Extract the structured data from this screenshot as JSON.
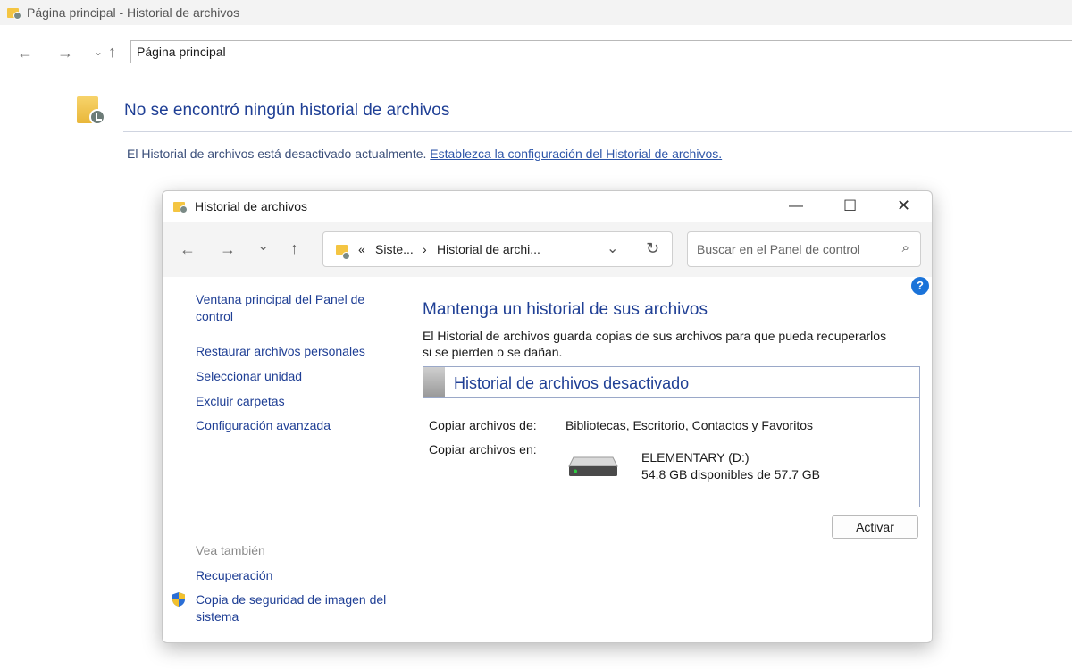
{
  "background_window": {
    "title": "Página principal - Historial de archivos",
    "address": "Página principal",
    "heading": "No se encontró ningún historial de archivos",
    "info_text": "El Historial de archivos está desactivado actualmente.",
    "info_link": "Establezca la configuración del Historial de archivos."
  },
  "dialog": {
    "title": "Historial de archivos",
    "breadcrumb": {
      "prefix": "«",
      "level1": "Siste...",
      "separator": "›",
      "level2": "Historial de archi..."
    },
    "search_placeholder": "Buscar en el Panel de control",
    "help_label": "?",
    "sidebar": {
      "items": [
        "Ventana principal del Panel de control",
        "Restaurar archivos personales",
        "Seleccionar unidad",
        "Excluir carpetas",
        "Configuración avanzada"
      ],
      "see_also_label": "Vea también",
      "see_also": [
        "Recuperación",
        "Copia de seguridad de imagen del sistema"
      ]
    },
    "main": {
      "heading": "Mantenga un historial de sus archivos",
      "description": "El Historial de archivos guarda copias de sus archivos para que pueda recuperarlos si se pierden o se dañan.",
      "status_title": "Historial de archivos desactivado",
      "copy_from_label": "Copiar archivos de:",
      "copy_from_value": "Bibliotecas, Escritorio, Contactos y Favoritos",
      "copy_to_label": "Copiar archivos en:",
      "drive_name": "ELEMENTARY (D:)",
      "drive_space": "54.8 GB disponibles de 57.7 GB",
      "activate_label": "Activar"
    }
  },
  "colors": {
    "link_blue": "#1f3f95",
    "help_blue": "#1a73d9",
    "panel_border": "#9aa8c8"
  }
}
